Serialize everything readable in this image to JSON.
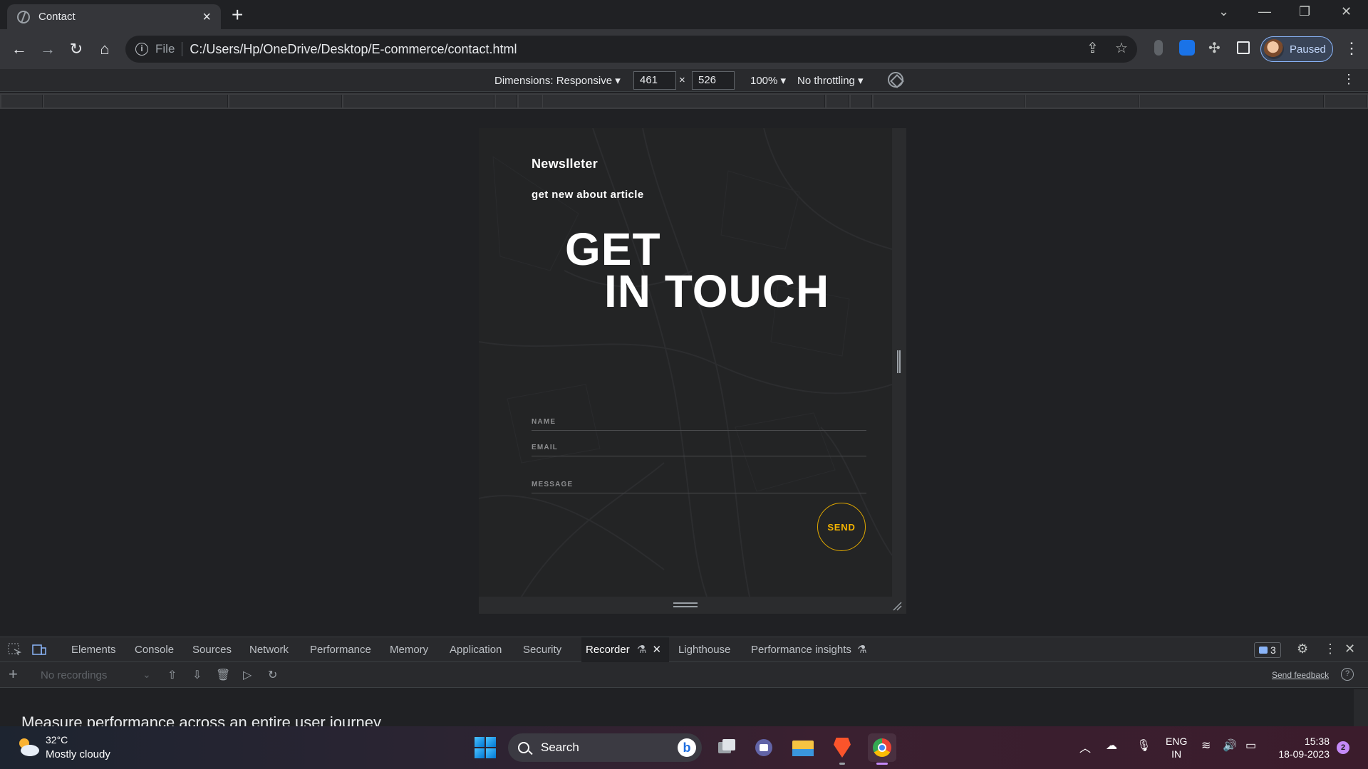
{
  "browser": {
    "tab_title": "Contact",
    "url_scheme": "File",
    "url": "C:/Users/Hp/OneDrive/Desktop/E-commerce/contact.html",
    "profile_status": "Paused"
  },
  "device_toolbar": {
    "dimensions_label": "Dimensions: Responsive ▾",
    "width": "461",
    "height": "526",
    "times": "×",
    "zoom": "100% ▾",
    "throttling": "No throttling ▾"
  },
  "page": {
    "newsletter_title": "Newslleter",
    "newsletter_subtitle": "get new about article",
    "heading_line1": "GET",
    "heading_line2": "IN TOUCH",
    "fields": {
      "name": "NAME",
      "email": "EMAIL",
      "message": "MESSAGE"
    },
    "send_label": "SEND",
    "accent_color": "#f4b400"
  },
  "devtools": {
    "tabs": [
      "Elements",
      "Console",
      "Sources",
      "Network",
      "Performance",
      "Memory",
      "Application",
      "Security",
      "Recorder",
      "Lighthouse",
      "Performance insights"
    ],
    "active_tab": "Recorder",
    "issues_count": "3",
    "recordings_placeholder": "No recordings",
    "send_feedback": "Send feedback",
    "recorder_headline": "Measure performance across an entire user journey"
  },
  "taskbar": {
    "temperature": "32°C",
    "weather": "Mostly cloudy",
    "search_label": "Search",
    "language_line1": "ENG",
    "language_line2": "IN",
    "time": "15:38",
    "date": "18-09-2023",
    "notification_count": "2"
  }
}
